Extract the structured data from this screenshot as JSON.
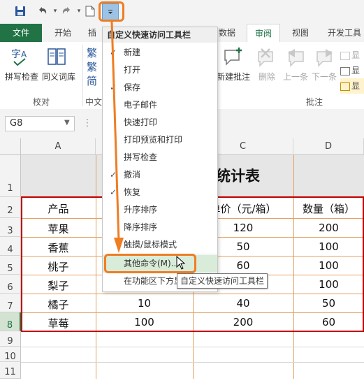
{
  "colors": {
    "accent": "#217346",
    "annotation": "#ef7d22",
    "highlight": "#d9ecd9",
    "table_border": "#c00000"
  },
  "qat": {
    "icons": [
      "save-icon",
      "undo-icon",
      "redo-icon",
      "new-doc-icon"
    ],
    "dropdown_icon": "customize-qat-dropdown-icon"
  },
  "tabs": {
    "file": "文件",
    "home": "开始",
    "insert": "插",
    "data": "数据",
    "review": "审阅",
    "view": "视图",
    "developer": "开发工具"
  },
  "ribbon": {
    "spell_check": "拼写检查",
    "thesaurus": "同义词库",
    "proofing_group": "校对",
    "chinese_group": "中文",
    "new_comment": "新建批注",
    "delete": "删除",
    "prev": "上一条",
    "next": "下一条",
    "comments_group": "批注",
    "show_partial": "显"
  },
  "namebox": "G8",
  "columns": [
    "A",
    "B",
    "C",
    "D"
  ],
  "rows": [
    "1",
    "2",
    "3",
    "4",
    "5",
    "6",
    "7",
    "8",
    "9",
    "10",
    "11"
  ],
  "sheet": {
    "title_partial": "售统计表",
    "headers": {
      "product": "产品",
      "price": "单价（元/箱）",
      "qty": "数量（箱）"
    },
    "rows": [
      {
        "a": "苹果",
        "c": "120",
        "d": "200"
      },
      {
        "a": "香蕉",
        "c": "50",
        "d": "100"
      },
      {
        "a": "桃子",
        "c": "60",
        "d": "100"
      },
      {
        "a": "梨子",
        "c": "",
        "d": "100"
      },
      {
        "a": "橘子",
        "b": "10",
        "c": "40",
        "d": "50"
      },
      {
        "a": "草莓",
        "b": "100",
        "c": "200",
        "d": "60"
      }
    ]
  },
  "menu": {
    "title": "自定义快速访问工具栏",
    "items": [
      {
        "label": "新建",
        "checked": "✓"
      },
      {
        "label": "打开",
        "checked": ""
      },
      {
        "label": "保存",
        "checked": "✓"
      },
      {
        "label": "电子邮件",
        "checked": ""
      },
      {
        "label": "快速打印",
        "checked": ""
      },
      {
        "label": "打印预览和打印",
        "checked": ""
      },
      {
        "label": "拼写检查",
        "checked": ""
      },
      {
        "label": "撤消",
        "checked": "✓"
      },
      {
        "label": "恢复",
        "checked": "✓"
      },
      {
        "label": "升序排序",
        "checked": ""
      },
      {
        "label": "降序排序",
        "checked": ""
      },
      {
        "label": "触摸/鼠标模式",
        "checked": ""
      },
      {
        "label": "其他命令(M)...",
        "checked": ""
      },
      {
        "label": "在功能区下方显示",
        "checked": ""
      }
    ]
  },
  "tooltip": "自定义快速访问工具栏"
}
